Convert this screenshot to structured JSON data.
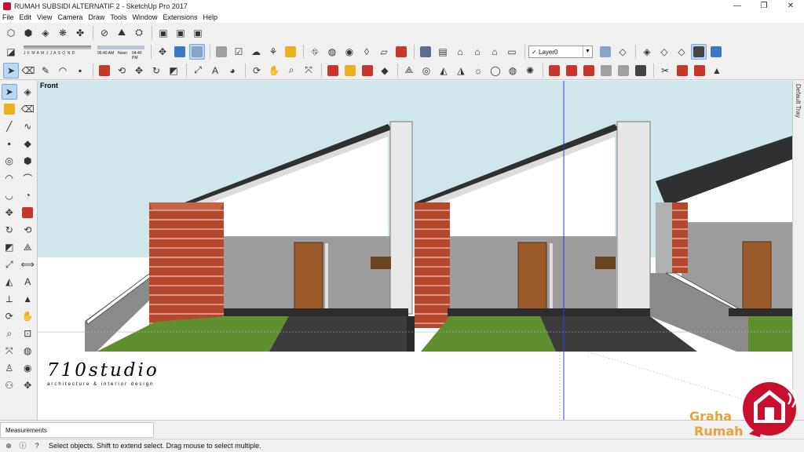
{
  "window": {
    "title": "RUMAH SUBSIDI ALTERNATIF 2 - SketchUp Pro 2017",
    "minimize": "—",
    "maximize": "❐",
    "close": "✕"
  },
  "menu": [
    "File",
    "Edit",
    "View",
    "Camera",
    "Draw",
    "Tools",
    "Window",
    "Extensions",
    "Help"
  ],
  "toolbar": {
    "shadow_months": "J F M A M J J A S O N D",
    "time_start": "06:40 AM",
    "time_mid": "Noon",
    "time_end": "04:40 PM",
    "layer_check": "✓",
    "layer_name": "Layer0",
    "layer_dropdown": "▼"
  },
  "viewport": {
    "view_label": "Front",
    "watermark_name": "710studio",
    "watermark_sub": "architecture & interior design"
  },
  "tray": {
    "label": "Default Tray"
  },
  "measurements": {
    "label": "Measurements"
  },
  "status": {
    "text": "Select objects. Shift to extend select. Drag mouse to select multiple."
  },
  "overlay_logo": {
    "line1": "Graha",
    "line2": "Rumah"
  },
  "colors": {
    "sky": "#cfe7ea",
    "brick": "#b5472c",
    "grass": "#5f8f2f",
    "wall_gray": "#9c9c9c",
    "door": "#9a5a2a",
    "logo_red": "#c8102e",
    "logo_orange": "#e8a33a"
  }
}
